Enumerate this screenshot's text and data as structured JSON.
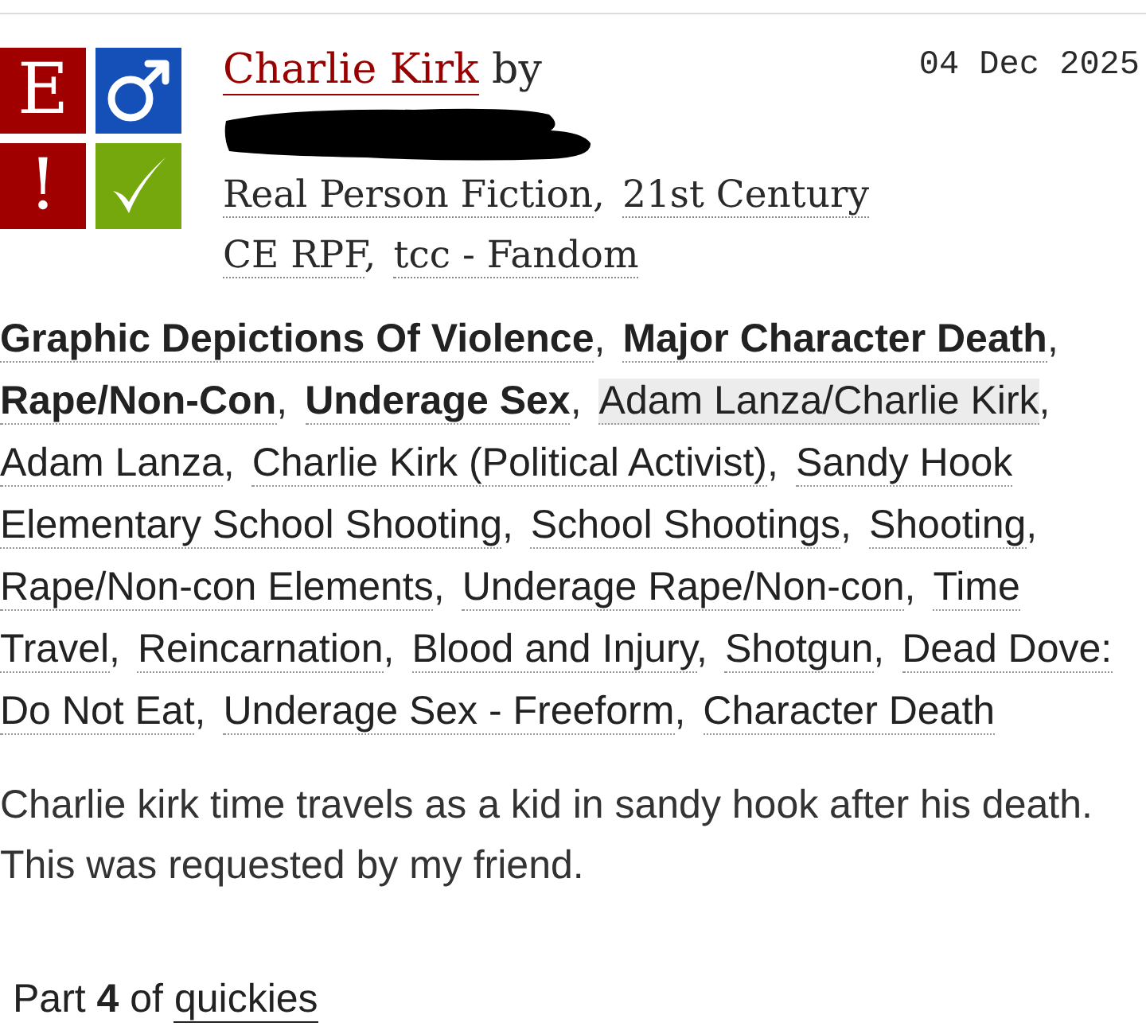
{
  "work": {
    "required_tags": [
      {
        "kind": "rating",
        "symbol": "E",
        "color": "#a00000"
      },
      {
        "kind": "category",
        "color": "#1450b8"
      },
      {
        "kind": "warning",
        "symbol": "!",
        "color": "#a00000"
      },
      {
        "kind": "status",
        "color": "#74a80c"
      }
    ],
    "title": "Charlie Kirk",
    "byline": "by",
    "author": {
      "redacted": true
    },
    "date": "04 Dec 2025",
    "fandoms": [
      {
        "label": "Real Person Fiction",
        "separator": ","
      },
      {
        "lines": [
          "21st Century",
          "CE RPF"
        ],
        "separator": ","
      },
      {
        "label": "tcc - Fandom"
      }
    ],
    "tags": [
      {
        "kind": "warning",
        "label": "Graphic Depictions Of Violence",
        "separator": ","
      },
      {
        "kind": "warning",
        "label": "Major Character Death",
        "separator": ","
      },
      {
        "kind": "warning",
        "label": "Rape/Non-Con",
        "separator": ","
      },
      {
        "kind": "warning",
        "label": "Underage Sex",
        "separator": ","
      },
      {
        "kind": "relationship",
        "label": "Adam Lanza/Charlie Kirk",
        "separator": ","
      },
      {
        "kind": "character",
        "label": "Adam Lanza",
        "separator": ","
      },
      {
        "kind": "character",
        "label": "Charlie Kirk (Political Activist)",
        "separator": ","
      },
      {
        "kind": "freeform",
        "lines": [
          "Sandy Hook",
          "Elementary School Shooting"
        ],
        "separator": ","
      },
      {
        "kind": "freeform",
        "label": "School Shootings",
        "separator": ","
      },
      {
        "kind": "freeform",
        "label": "Shooting",
        "separator": ","
      },
      {
        "kind": "freeform",
        "label": "Rape/Non-con Elements",
        "separator": ","
      },
      {
        "kind": "freeform",
        "label": "Underage Rape/Non-con",
        "separator": ","
      },
      {
        "kind": "freeform",
        "lines": [
          "Time",
          "Travel"
        ],
        "separator": ","
      },
      {
        "kind": "freeform",
        "label": "Reincarnation",
        "separator": ","
      },
      {
        "kind": "freeform",
        "label": "Blood and Injury",
        "separator": ","
      },
      {
        "kind": "freeform",
        "label": "Shotgun",
        "separator": ","
      },
      {
        "kind": "freeform",
        "lines": [
          "Dead Dove:",
          "Do Not Eat"
        ],
        "separator": ","
      },
      {
        "kind": "freeform",
        "label": "Underage Sex - Freeform",
        "separator": ","
      },
      {
        "kind": "freeform",
        "label": "Character Death"
      }
    ],
    "summary": [
      "Charlie kirk time travels as a kid in sandy hook after his death.",
      "This was requested by my friend."
    ],
    "series": {
      "text": "Part **4** of",
      "link": "quickies"
    }
  }
}
